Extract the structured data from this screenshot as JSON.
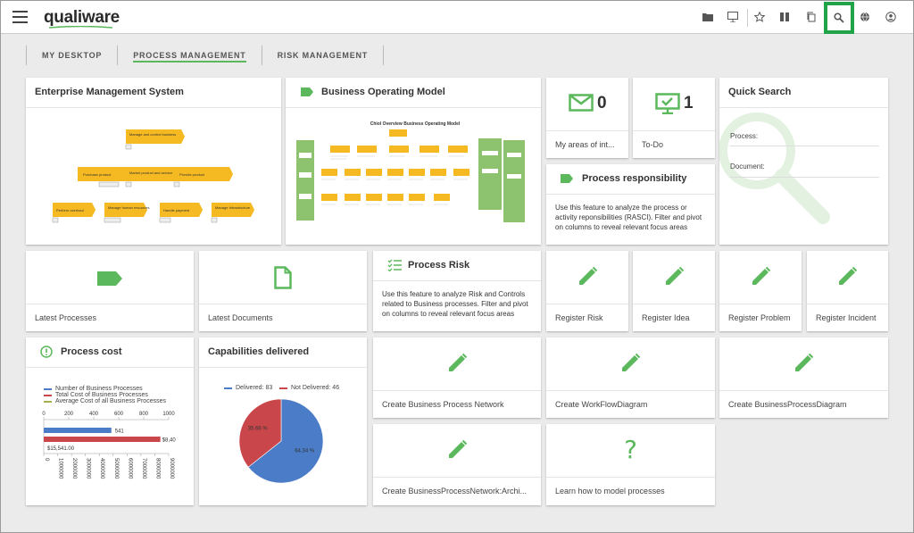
{
  "app": {
    "logo": "qualiware"
  },
  "toolbar": {
    "icons": [
      "folder-icon",
      "presentation-icon",
      "star-icon",
      "book-icon",
      "copy-icon",
      "search-icon",
      "globe-icon",
      "user-icon"
    ]
  },
  "tabs": [
    {
      "label": "MY DESKTOP",
      "active": false
    },
    {
      "label": "PROCESS MANAGEMENT",
      "active": true
    },
    {
      "label": "RISK MANAGEMENT",
      "active": false
    }
  ],
  "enterprise": {
    "title": "Enterprise Management System",
    "diagram_boxes": [
      "Manage and control business",
      "Purchase product",
      "Market product and service",
      "Provide product",
      "Perform overhaul",
      "Manage human resources",
      "Handle payment",
      "Manage Infrastructure"
    ]
  },
  "bom": {
    "title": "Business Operating Model",
    "diagram_title": "Chiol Overview Business Operating Model"
  },
  "areas": {
    "count": "0",
    "label": "My areas of int..."
  },
  "todo": {
    "count": "1",
    "label": "To-Do"
  },
  "quicksearch": {
    "title": "Quick Search",
    "process_label": "Process:",
    "document_label": "Document:"
  },
  "responsibility": {
    "title": "Process responsibility",
    "desc": "Use this feature to analyze the process or activity reponsibilities (RASCI). Filter and pivot on columns to reveal relevant focus areas"
  },
  "latest_processes": {
    "label": "Latest Processes"
  },
  "latest_documents": {
    "label": "Latest Documents"
  },
  "process_risk": {
    "title": "Process Risk",
    "desc": "Use this feature to analyze Risk and Controls related to Business processes. Filter and pivot on columns to reveal relevant focus areas"
  },
  "register_risk": {
    "label": "Register Risk"
  },
  "register_idea": {
    "label": "Register Idea"
  },
  "register_problem": {
    "label": "Register Problem"
  },
  "register_incident": {
    "label": "Register Incident"
  },
  "process_cost": {
    "title": "Process cost",
    "legend": [
      "Number of Business Processes",
      "Total Cost of Business Processes",
      "Average Cost of all Business Processes"
    ],
    "top_ticks": [
      "0",
      "200",
      "400",
      "600",
      "800",
      "1000"
    ],
    "bottom_ticks": [
      "0",
      "1000000",
      "2000000",
      "3000000",
      "4000000",
      "5000000",
      "6000000",
      "7000000",
      "8000000",
      "9000000"
    ],
    "bar_number_label": "541",
    "bar_total_label": "$8,40",
    "bar_avg_label": "$15,541.00"
  },
  "capabilities": {
    "title": "Capabilities delivered",
    "legend_delivered": "Delivered: 83",
    "legend_not": "Not Delivered: 46",
    "slice_delivered_label": "64.34 %",
    "slice_not_label": "35.66 %"
  },
  "create_bpn": {
    "label": "Create Business Process Network"
  },
  "create_wfd": {
    "label": "Create WorkFlowDiagram"
  },
  "create_bpd": {
    "label": "Create BusinessProcessDiagram"
  },
  "create_bpn_arch": {
    "label": "Create BusinessProcessNetwork:Archi..."
  },
  "learn": {
    "label": "Learn how to model processes"
  },
  "colors": {
    "accent": "#5cb85c",
    "highlight": "#21a34a",
    "blue": "#4a7cc7",
    "red": "#c9474b",
    "olive": "#a5b04a"
  },
  "chart_data": [
    {
      "type": "bar",
      "title": "Process cost",
      "series": [
        {
          "name": "Number of Business Processes",
          "values": [
            541
          ]
        },
        {
          "name": "Total Cost of Business Processes",
          "values": [
            8400000
          ]
        },
        {
          "name": "Average Cost of all Business Processes",
          "values": [
            15541
          ]
        }
      ],
      "top_axis_range": [
        0,
        1000
      ],
      "bottom_axis_range": [
        0,
        9000000
      ]
    },
    {
      "type": "pie",
      "title": "Capabilities delivered",
      "categories": [
        "Delivered",
        "Not Delivered"
      ],
      "values": [
        83,
        46
      ],
      "percent_labels": [
        "64.34 %",
        "35.66 %"
      ]
    }
  ]
}
